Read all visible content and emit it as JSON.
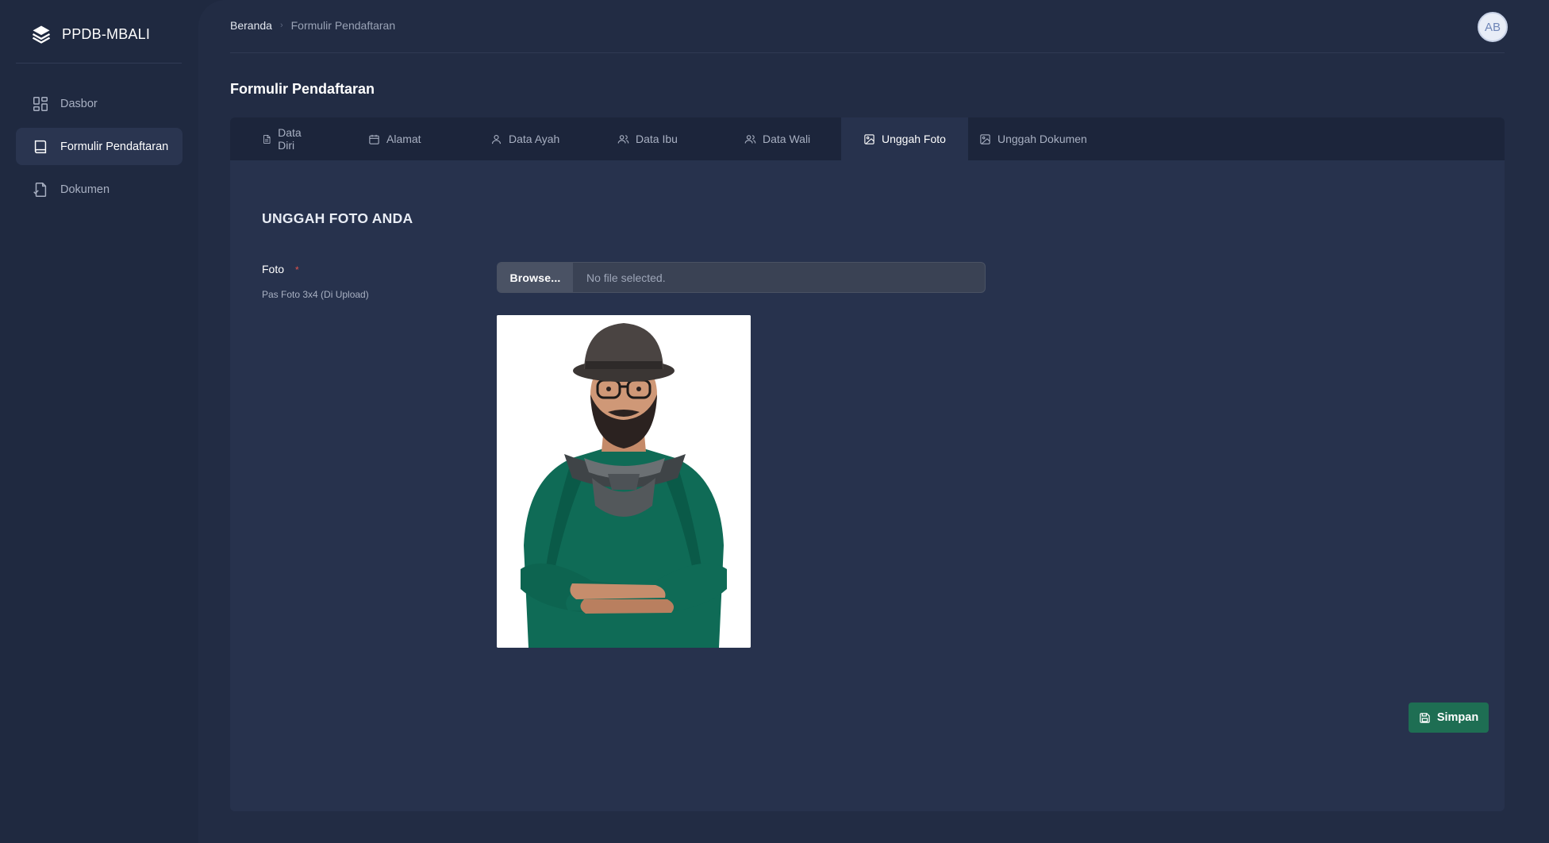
{
  "brand": {
    "name": "PPDB-MBALI"
  },
  "sidebar": {
    "items": [
      {
        "label": "Dasbor",
        "icon": "dashboard-icon"
      },
      {
        "label": "Formulir Pendaftaran",
        "icon": "book-icon",
        "active": true
      },
      {
        "label": "Dokumen",
        "icon": "document-check-icon"
      }
    ]
  },
  "breadcrumb": {
    "home": "Beranda",
    "current": "Formulir Pendaftaran"
  },
  "user": {
    "initials": "AB"
  },
  "page": {
    "title": "Formulir Pendaftaran"
  },
  "tabs": [
    {
      "label": "Data Diri",
      "icon": "file-text-icon"
    },
    {
      "label": "Alamat",
      "icon": "calendar-icon"
    },
    {
      "label": "Data Ayah",
      "icon": "user-icon"
    },
    {
      "label": "Data Ibu",
      "icon": "users-icon"
    },
    {
      "label": "Data Wali",
      "icon": "users-icon"
    },
    {
      "label": "Unggah Foto",
      "icon": "image-icon",
      "active": true
    },
    {
      "label": "Unggah Dokumen",
      "icon": "image-icon"
    }
  ],
  "form": {
    "section_title": "UNGGAH FOTO ANDA",
    "field_label": "Foto",
    "required_mark": "*",
    "field_help": "Pas Foto 3x4 (Di Upload)",
    "browse_label": "Browse...",
    "file_status": "No file selected.",
    "save_label": "Simpan"
  },
  "colors": {
    "accent_green": "#1e6e53",
    "sidebar_bg": "#1f2940",
    "card_bg": "#27324d"
  }
}
